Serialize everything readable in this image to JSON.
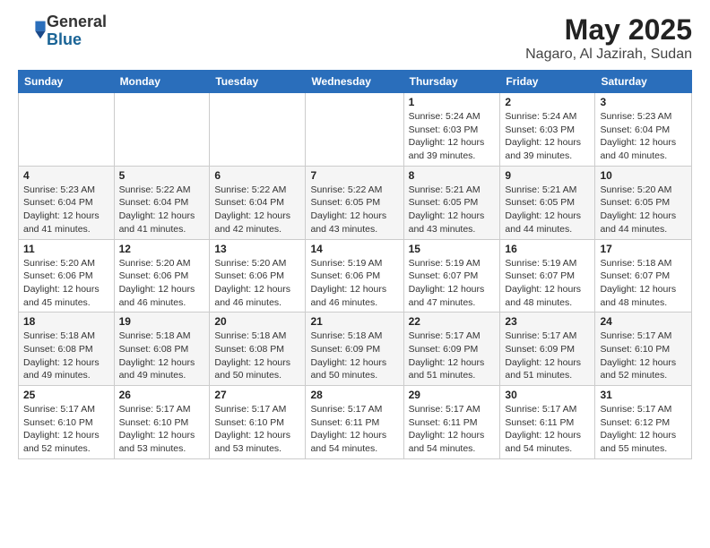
{
  "header": {
    "logo_line1": "General",
    "logo_line2": "Blue",
    "title": "May 2025",
    "subtitle": "Nagaro, Al Jazirah, Sudan"
  },
  "weekdays": [
    "Sunday",
    "Monday",
    "Tuesday",
    "Wednesday",
    "Thursday",
    "Friday",
    "Saturday"
  ],
  "weeks": [
    [
      {
        "day": "",
        "info": ""
      },
      {
        "day": "",
        "info": ""
      },
      {
        "day": "",
        "info": ""
      },
      {
        "day": "",
        "info": ""
      },
      {
        "day": "1",
        "info": "Sunrise: 5:24 AM\nSunset: 6:03 PM\nDaylight: 12 hours\nand 39 minutes."
      },
      {
        "day": "2",
        "info": "Sunrise: 5:24 AM\nSunset: 6:03 PM\nDaylight: 12 hours\nand 39 minutes."
      },
      {
        "day": "3",
        "info": "Sunrise: 5:23 AM\nSunset: 6:04 PM\nDaylight: 12 hours\nand 40 minutes."
      }
    ],
    [
      {
        "day": "4",
        "info": "Sunrise: 5:23 AM\nSunset: 6:04 PM\nDaylight: 12 hours\nand 41 minutes."
      },
      {
        "day": "5",
        "info": "Sunrise: 5:22 AM\nSunset: 6:04 PM\nDaylight: 12 hours\nand 41 minutes."
      },
      {
        "day": "6",
        "info": "Sunrise: 5:22 AM\nSunset: 6:04 PM\nDaylight: 12 hours\nand 42 minutes."
      },
      {
        "day": "7",
        "info": "Sunrise: 5:22 AM\nSunset: 6:05 PM\nDaylight: 12 hours\nand 43 minutes."
      },
      {
        "day": "8",
        "info": "Sunrise: 5:21 AM\nSunset: 6:05 PM\nDaylight: 12 hours\nand 43 minutes."
      },
      {
        "day": "9",
        "info": "Sunrise: 5:21 AM\nSunset: 6:05 PM\nDaylight: 12 hours\nand 44 minutes."
      },
      {
        "day": "10",
        "info": "Sunrise: 5:20 AM\nSunset: 6:05 PM\nDaylight: 12 hours\nand 44 minutes."
      }
    ],
    [
      {
        "day": "11",
        "info": "Sunrise: 5:20 AM\nSunset: 6:06 PM\nDaylight: 12 hours\nand 45 minutes."
      },
      {
        "day": "12",
        "info": "Sunrise: 5:20 AM\nSunset: 6:06 PM\nDaylight: 12 hours\nand 46 minutes."
      },
      {
        "day": "13",
        "info": "Sunrise: 5:20 AM\nSunset: 6:06 PM\nDaylight: 12 hours\nand 46 minutes."
      },
      {
        "day": "14",
        "info": "Sunrise: 5:19 AM\nSunset: 6:06 PM\nDaylight: 12 hours\nand 46 minutes."
      },
      {
        "day": "15",
        "info": "Sunrise: 5:19 AM\nSunset: 6:07 PM\nDaylight: 12 hours\nand 47 minutes."
      },
      {
        "day": "16",
        "info": "Sunrise: 5:19 AM\nSunset: 6:07 PM\nDaylight: 12 hours\nand 48 minutes."
      },
      {
        "day": "17",
        "info": "Sunrise: 5:18 AM\nSunset: 6:07 PM\nDaylight: 12 hours\nand 48 minutes."
      }
    ],
    [
      {
        "day": "18",
        "info": "Sunrise: 5:18 AM\nSunset: 6:08 PM\nDaylight: 12 hours\nand 49 minutes."
      },
      {
        "day": "19",
        "info": "Sunrise: 5:18 AM\nSunset: 6:08 PM\nDaylight: 12 hours\nand 49 minutes."
      },
      {
        "day": "20",
        "info": "Sunrise: 5:18 AM\nSunset: 6:08 PM\nDaylight: 12 hours\nand 50 minutes."
      },
      {
        "day": "21",
        "info": "Sunrise: 5:18 AM\nSunset: 6:09 PM\nDaylight: 12 hours\nand 50 minutes."
      },
      {
        "day": "22",
        "info": "Sunrise: 5:17 AM\nSunset: 6:09 PM\nDaylight: 12 hours\nand 51 minutes."
      },
      {
        "day": "23",
        "info": "Sunrise: 5:17 AM\nSunset: 6:09 PM\nDaylight: 12 hours\nand 51 minutes."
      },
      {
        "day": "24",
        "info": "Sunrise: 5:17 AM\nSunset: 6:10 PM\nDaylight: 12 hours\nand 52 minutes."
      }
    ],
    [
      {
        "day": "25",
        "info": "Sunrise: 5:17 AM\nSunset: 6:10 PM\nDaylight: 12 hours\nand 52 minutes."
      },
      {
        "day": "26",
        "info": "Sunrise: 5:17 AM\nSunset: 6:10 PM\nDaylight: 12 hours\nand 53 minutes."
      },
      {
        "day": "27",
        "info": "Sunrise: 5:17 AM\nSunset: 6:10 PM\nDaylight: 12 hours\nand 53 minutes."
      },
      {
        "day": "28",
        "info": "Sunrise: 5:17 AM\nSunset: 6:11 PM\nDaylight: 12 hours\nand 54 minutes."
      },
      {
        "day": "29",
        "info": "Sunrise: 5:17 AM\nSunset: 6:11 PM\nDaylight: 12 hours\nand 54 minutes."
      },
      {
        "day": "30",
        "info": "Sunrise: 5:17 AM\nSunset: 6:11 PM\nDaylight: 12 hours\nand 54 minutes."
      },
      {
        "day": "31",
        "info": "Sunrise: 5:17 AM\nSunset: 6:12 PM\nDaylight: 12 hours\nand 55 minutes."
      }
    ]
  ]
}
